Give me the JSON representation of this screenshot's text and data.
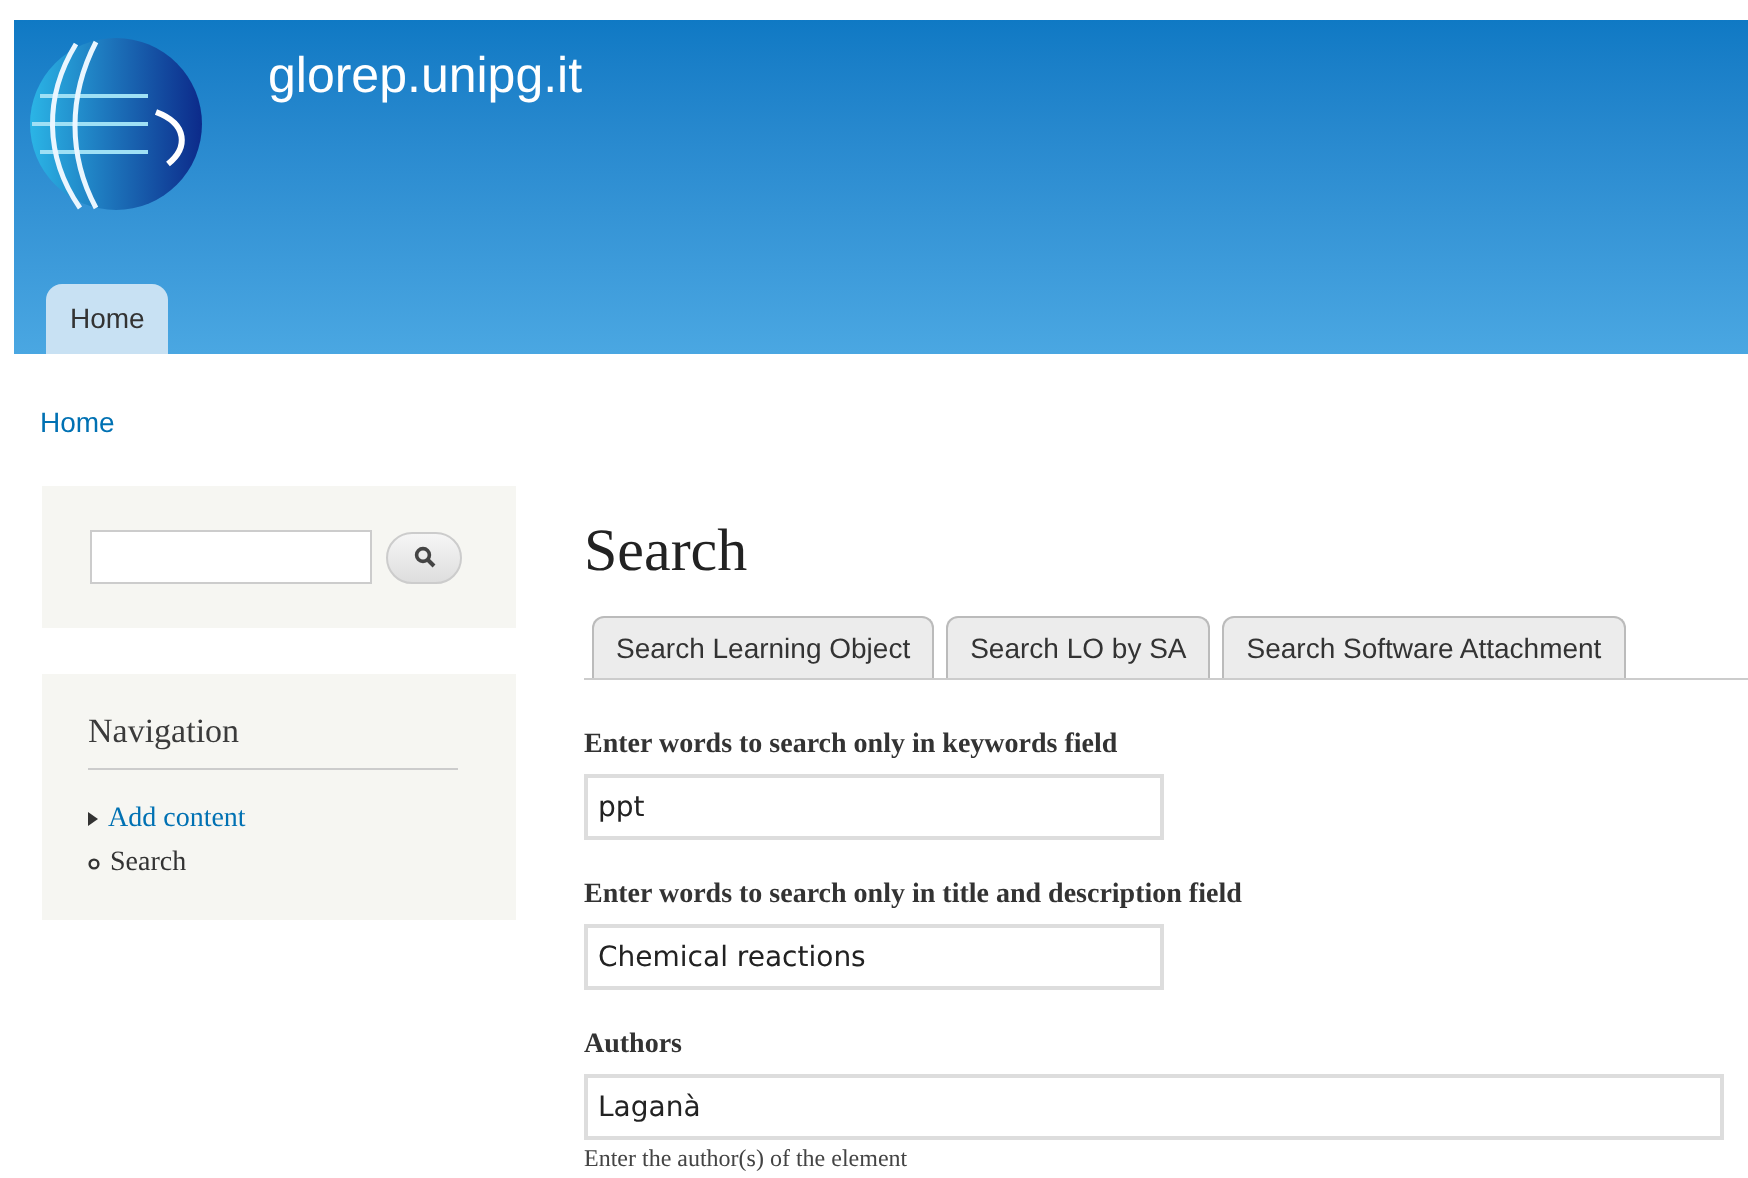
{
  "header": {
    "site_name": "glorep.unipg.it",
    "tabs": [
      {
        "label": "Home",
        "selected": true
      }
    ]
  },
  "breadcrumb": "Home",
  "sidebar": {
    "navigation": {
      "title": "Navigation",
      "items": [
        {
          "label": "Add content",
          "kind": "collapsed"
        },
        {
          "label": "Search",
          "kind": "leaf"
        }
      ]
    }
  },
  "main": {
    "title": "Search",
    "tabs": [
      {
        "label": "Search Learning Object",
        "selected": false
      },
      {
        "label": "Search LO by SA",
        "selected": false
      },
      {
        "label": "Search Software Attachment",
        "selected": false
      }
    ],
    "fields": [
      {
        "label": "Enter words to search only in keywords field",
        "value": "ppt",
        "kind": "short"
      },
      {
        "label": "Enter words to search only in title and description field",
        "value": "Chemical reactions",
        "kind": "short"
      },
      {
        "label": "Authors",
        "value": "Laganà",
        "kind": "wide",
        "help": "Enter the author(s) of the element"
      }
    ]
  }
}
